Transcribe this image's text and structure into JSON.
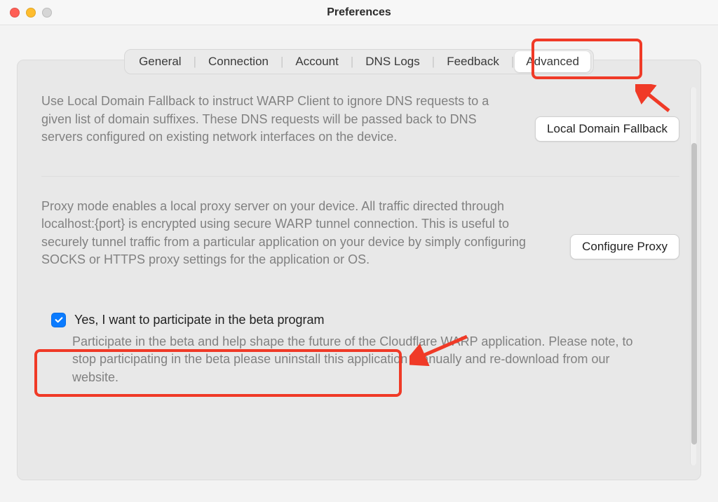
{
  "window": {
    "title": "Preferences"
  },
  "tabs": {
    "items": [
      "General",
      "Connection",
      "Account",
      "DNS Logs",
      "Feedback",
      "Advanced"
    ],
    "active": "Advanced"
  },
  "sections": {
    "localDomain": {
      "desc": "Use Local Domain Fallback to instruct WARP Client to ignore DNS requests to a given list of domain suffixes. These DNS requests will be passed back to DNS servers configured on existing network interfaces on the device.",
      "button": "Local Domain Fallback"
    },
    "proxy": {
      "desc": "Proxy mode enables a local proxy server on your device. All traffic directed through localhost:{port} is encrypted using secure WARP tunnel connection. This is useful to securely tunnel traffic from a particular application on your device by simply configuring SOCKS or HTTPS proxy settings for the application or OS.",
      "button": "Configure Proxy"
    },
    "beta": {
      "checked": true,
      "label": "Yes, I want to participate in the beta program",
      "desc": "Participate in the beta and help shape the future of the Cloudflare WARP application. Please note, to stop participating in the beta please uninstall this application manually and re-download from our website."
    }
  },
  "annotations": {
    "highlight_advanced": true,
    "highlight_beta": true
  }
}
